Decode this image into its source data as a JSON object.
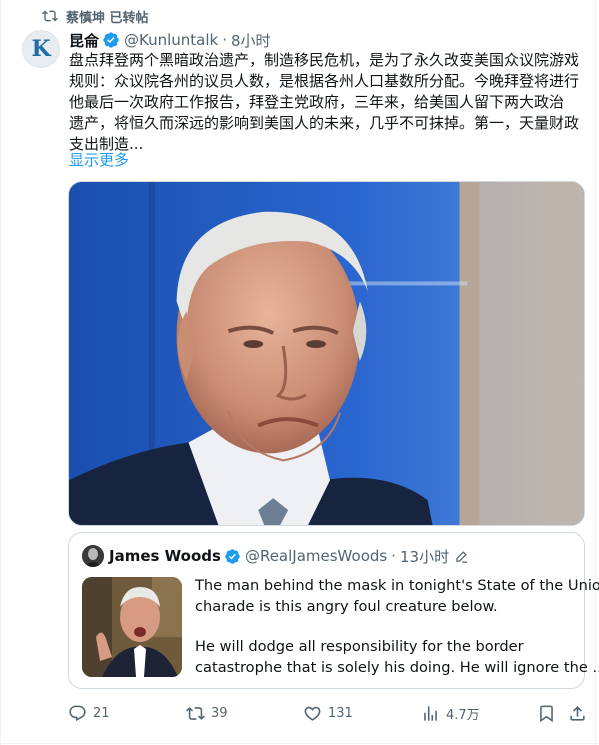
{
  "repost": {
    "label": "蔡慎坤 已转帖"
  },
  "tweet": {
    "author_name": "昆侖",
    "avatar_letter": "K",
    "handle": "@Kunluntalk",
    "separator": "·",
    "time": "8小时",
    "text_lines": [
      "盘点拜登两个黑暗政治遗产，制造移民危机，是为了永久改变美国众议院游戏",
      "规则：众议院各州的议员人数，是根据各州人口基数所分配。今晚拜登将进行",
      "他最后一次政府工作报告，拜登主党政府，三年来，给美国人留下两大政治",
      "遗产，将恒久而深远的影响到美国人的未来，几乎不可抹掉。第一，天量财政",
      "支出制造..."
    ],
    "show_more": "显示更多"
  },
  "quote": {
    "author_name": "James Woods",
    "handle": "@RealJamesWoods",
    "separator": "·",
    "time": "13小时",
    "text_lines_1": [
      "The man behind the mask in tonight's State of the Union",
      "charade is this angry foul creature below."
    ],
    "text_lines_2": [
      "He will dodge all responsibility for the border",
      "catastrophe that is solely his doing. He will ignore the ..."
    ]
  },
  "actions": {
    "replies": "21",
    "reposts": "39",
    "likes": "131",
    "views": "4.7万"
  },
  "icons": {
    "repost": "repost-icon",
    "verified": "verified-badge-icon",
    "edit": "edit-pencil-icon",
    "reply": "reply-icon",
    "like": "heart-icon",
    "views": "views-chart-icon",
    "bookmark": "bookmark-icon",
    "share": "share-icon"
  },
  "colors": {
    "accent": "#1d9bf0",
    "secondary_text": "#536471",
    "border": "#cfd9de"
  }
}
